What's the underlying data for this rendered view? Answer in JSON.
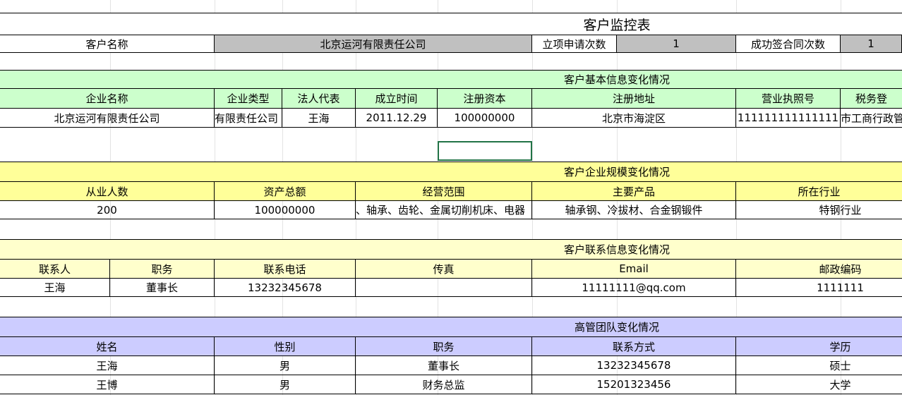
{
  "title": "客户监控表",
  "summary": {
    "name_label": "客户名称",
    "name_value": "北京运河有限责任公司",
    "apply_label": "立项申请次数",
    "apply_value": "1",
    "sign_label": "成功签合同次数",
    "sign_value": "1"
  },
  "basic": {
    "section_title": "客户基本信息变化情况",
    "headers": [
      "企业名称",
      "企业类型",
      "法人代表",
      "成立时间",
      "注册资本",
      "注册地址",
      "营业执照号",
      "税务登"
    ],
    "values": [
      "北京运河有限责任公司",
      "有限责任公司",
      "王海",
      "2011.12.29",
      "100000000",
      "北京市海淀区",
      "111111111111111",
      "市工商行政管"
    ]
  },
  "scale": {
    "section_title": "客户企业规模变化情况",
    "headers": [
      "从业人数",
      "资产总额",
      "经营范围",
      "主要产品",
      "所在行业"
    ],
    "values": [
      "200",
      "100000000",
      "、轴承、齿轮、金属切削机床、电器",
      "轴承钢、冷拔材、合金钢锻件",
      "特钢行业"
    ]
  },
  "contact": {
    "section_title": "客户联系信息变化情况",
    "headers": [
      "联系人",
      "职务",
      "联系电话",
      "传真",
      "Email",
      "邮政编码"
    ],
    "values": [
      "王海",
      "董事长",
      "13232345678",
      "",
      "11111111@qq.com",
      "1111111"
    ]
  },
  "team": {
    "section_title": "高管团队变化情况",
    "headers": [
      "姓名",
      "性别",
      "职务",
      "联系方式",
      "学历"
    ],
    "rows": [
      [
        "王海",
        "男",
        "董事长",
        "13232345678",
        "硕士"
      ],
      [
        "王博",
        "男",
        "财务总监",
        "15201323456",
        "大学"
      ]
    ]
  }
}
